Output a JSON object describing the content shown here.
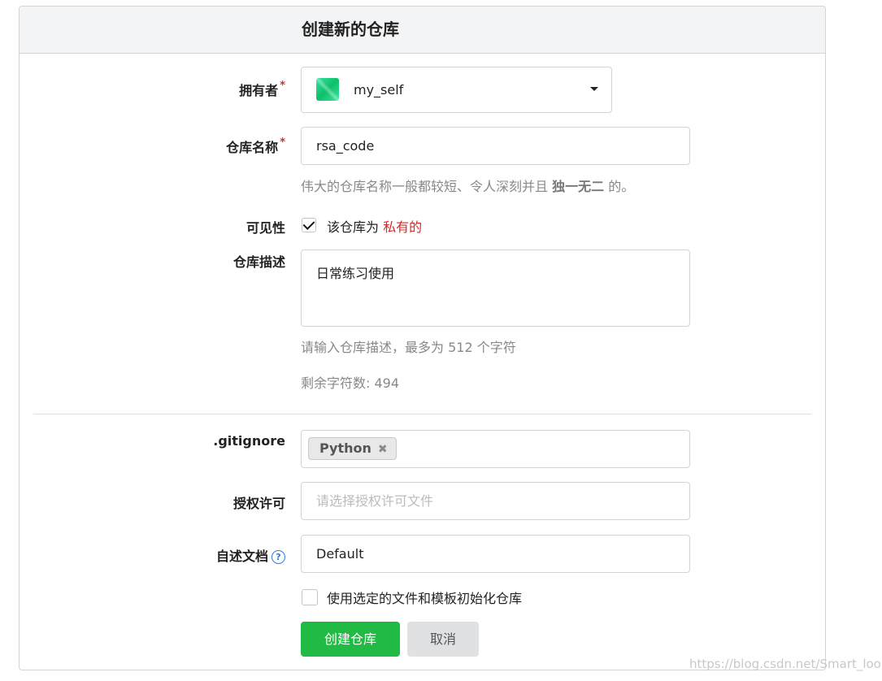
{
  "form": {
    "title": "创建新的仓库",
    "required_mark": "*",
    "owner": {
      "label": "拥有者",
      "value": "my_self"
    },
    "repo_name": {
      "label": "仓库名称",
      "value": "rsa_code",
      "help_prefix": "伟大的仓库名称一般都较短、令人深刻并且",
      "help_bold": "独一无二",
      "help_suffix": "的。"
    },
    "visibility": {
      "label": "可见性",
      "checked": true,
      "text": "该仓库为",
      "highlight": "私有的"
    },
    "description": {
      "label": "仓库描述",
      "value": "日常练习使用",
      "help": "请输入仓库描述，最多为 512 个字符",
      "remaining": "剩余字符数: 494"
    },
    "gitignore": {
      "label": ".gitignore",
      "tag": "Python",
      "tag_remove": "✖"
    },
    "license": {
      "label": "授权许可",
      "placeholder": "请选择授权许可文件"
    },
    "readme": {
      "label": "自述文档",
      "help_icon": "?",
      "value": "Default"
    },
    "auto_init": {
      "checked": false,
      "text": "使用选定的文件和模板初始化仓库"
    },
    "buttons": {
      "create": "创建仓库",
      "cancel": "取消"
    }
  },
  "watermark": "https://blog.csdn.net/Smart_look",
  "colors": {
    "primary": "#21ba45",
    "required": "#db2828",
    "private": "#db2828",
    "help": "#888888"
  }
}
